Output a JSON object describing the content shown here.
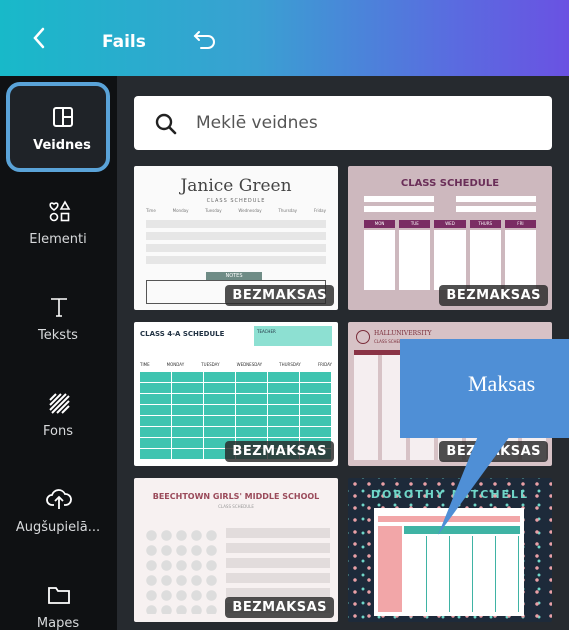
{
  "topbar": {
    "back_icon": "chevron-left-icon",
    "title": "Fails",
    "undo_icon": "undo-icon"
  },
  "sidebar": {
    "items": [
      {
        "label": "Veidnes",
        "icon": "template-icon",
        "active": true
      },
      {
        "label": "Elementi",
        "icon": "shapes-icon",
        "active": false
      },
      {
        "label": "Teksts",
        "icon": "text-icon",
        "active": false
      },
      {
        "label": "Fons",
        "icon": "background-icon",
        "active": false
      },
      {
        "label": "Augšupielā...",
        "icon": "upload-icon",
        "active": false
      },
      {
        "label": "Mapes",
        "icon": "folder-icon",
        "active": false
      }
    ]
  },
  "search": {
    "placeholder": "Meklē veidnes",
    "icon": "search-icon"
  },
  "templates": [
    {
      "title": "Janice Green",
      "subtitle": "CLASS SCHEDULE",
      "cols": [
        "Time",
        "Monday",
        "Tuesday",
        "Wednesday",
        "Thursday",
        "Friday"
      ],
      "button": "NOTES",
      "badge": "BEZMAKSAS"
    },
    {
      "title": "CLASS SCHEDULE",
      "days": [
        "MON",
        "TUE",
        "WED",
        "THURS",
        "FRI"
      ],
      "badge": "BEZMAKSAS"
    },
    {
      "title": "CLASS 4-A SCHEDULE",
      "subtitle": "TEACHER",
      "cols": [
        "TIME",
        "MONDAY",
        "TUESDAY",
        "WEDNESDAY",
        "THURSDAY",
        "FRIDAY"
      ],
      "badge": "BEZMAKSAS"
    },
    {
      "title": "HALLUNIVERSITY",
      "subtitle": "CLASS SCHEDULE",
      "badge": "BEZMAKSAS"
    },
    {
      "title": "BEECHTOWN GIRLS' MIDDLE SCHOOL",
      "subtitle": "CLASS SCHEDULE",
      "badge": "BEZMAKSAS"
    },
    {
      "title": "DOROTHY MITCHELL",
      "badge": ""
    }
  ],
  "callout": {
    "text": "Maksas"
  },
  "colors": {
    "gradient_start": "#18b9c9",
    "gradient_end": "#6a52e2",
    "active_border": "#5aa3d8",
    "callout": "#4f8fd6"
  }
}
